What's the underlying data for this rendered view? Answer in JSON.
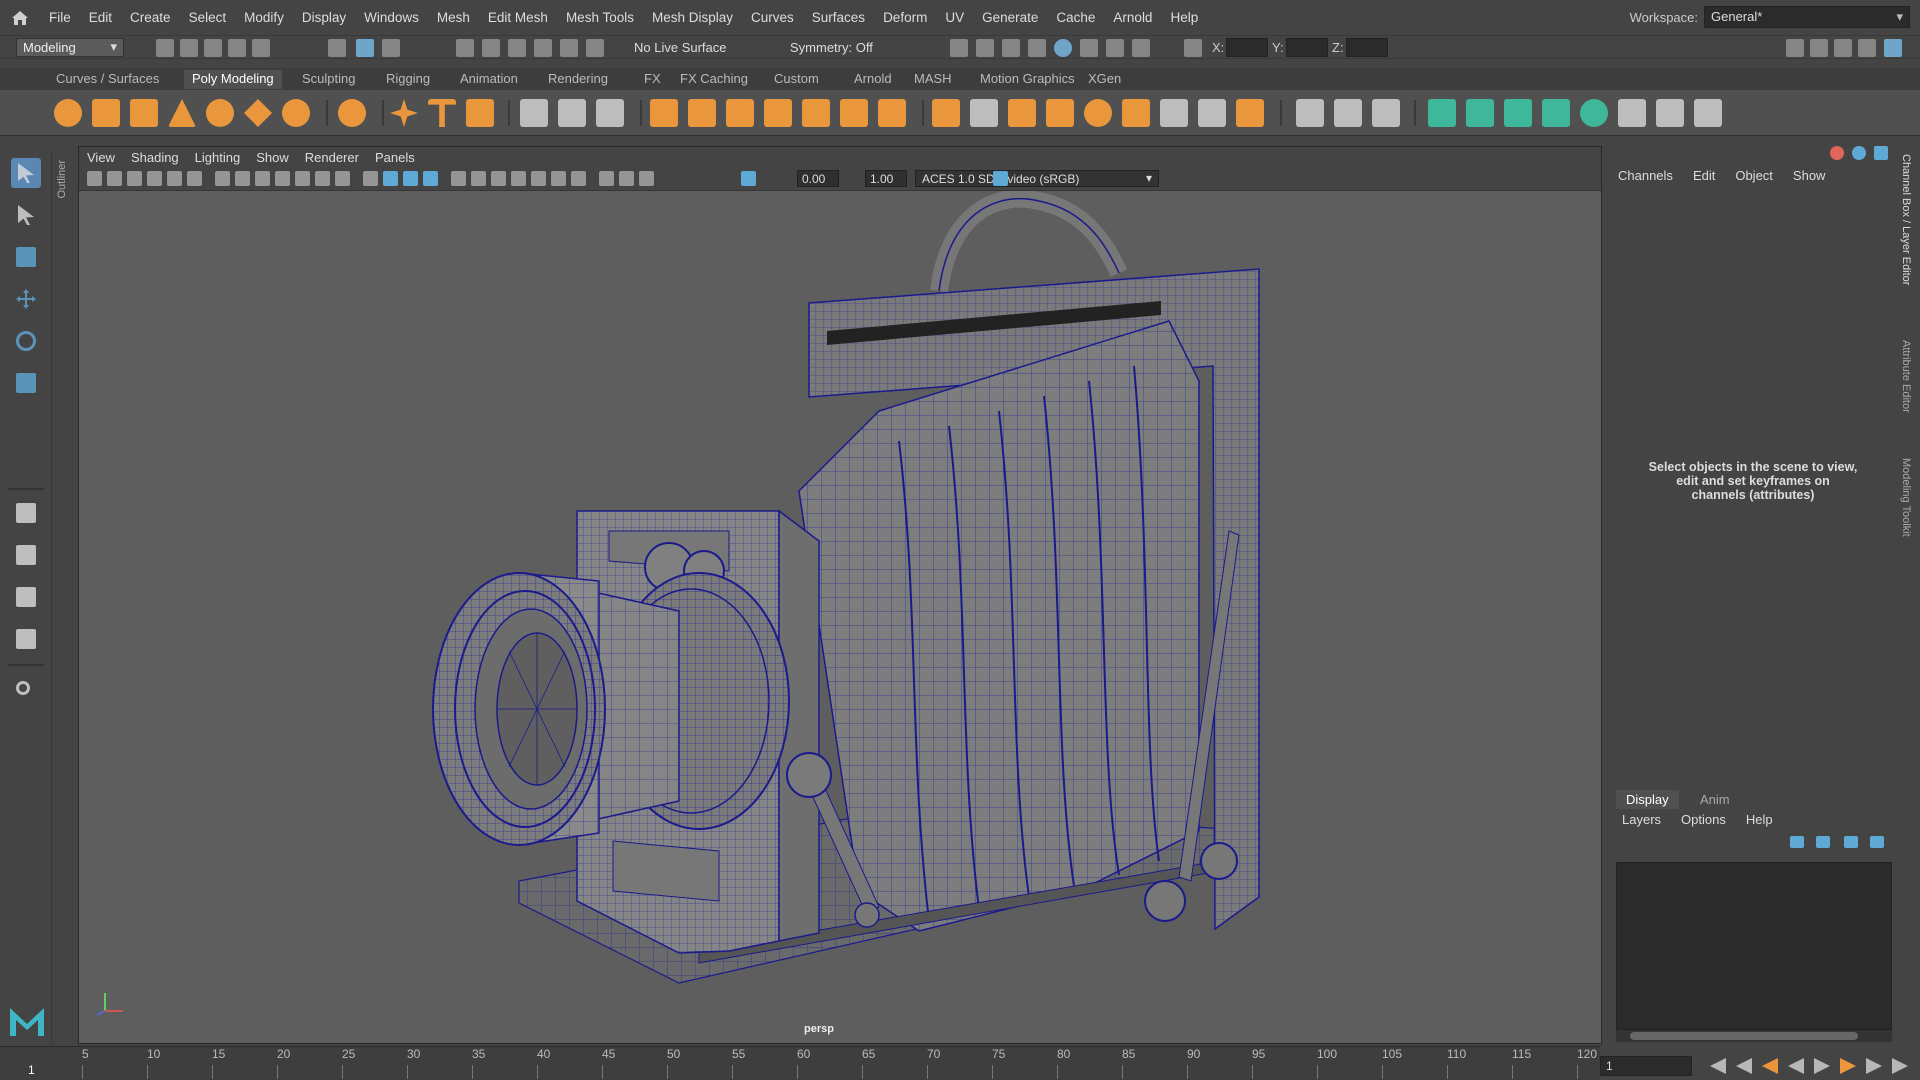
{
  "menus": [
    "File",
    "Edit",
    "Create",
    "Select",
    "Modify",
    "Display",
    "Windows",
    "Mesh",
    "Edit Mesh",
    "Mesh Tools",
    "Mesh Display",
    "Curves",
    "Surfaces",
    "Deform",
    "UV",
    "Generate",
    "Cache",
    "Arnold",
    "Help"
  ],
  "workspace": {
    "label": "Workspace:",
    "value": "General*"
  },
  "status": {
    "mode": "Modeling",
    "live_surface": "No Live Surface",
    "symmetry": "Symmetry: Off",
    "x_label": "X:",
    "y_label": "Y:",
    "z_label": "Z:"
  },
  "shelf_tabs": [
    "Curves / Surfaces",
    "Poly Modeling",
    "Sculpting",
    "Rigging",
    "Animation",
    "Rendering",
    "FX",
    "FX Caching",
    "Custom",
    "Arnold",
    "MASH",
    "Motion Graphics",
    "XGen"
  ],
  "shelf_active": "Poly Modeling",
  "outliner_label": "Outliner",
  "viewport": {
    "menus": [
      "View",
      "Shading",
      "Lighting",
      "Show",
      "Renderer",
      "Panels"
    ],
    "exposure": "0.00",
    "gamma": "1.00",
    "color_space": "ACES 1.0 SDR-video (sRGB)",
    "camera": "persp"
  },
  "channel_box": {
    "menus": [
      "Channels",
      "Edit",
      "Object",
      "Show"
    ],
    "hint": "Select objects in the scene to view, edit and set keyframes on channels (attributes)"
  },
  "side_tabs": [
    "Channel Box / Layer Editor",
    "Attribute Editor",
    "Modeling Toolkit"
  ],
  "layers": {
    "tabs": [
      "Display",
      "Anim"
    ],
    "menus": [
      "Layers",
      "Options",
      "Help"
    ]
  },
  "timeline": {
    "ticks": [
      "5",
      "10",
      "15",
      "20",
      "25",
      "30",
      "35",
      "40",
      "45",
      "50",
      "55",
      "60",
      "65",
      "70",
      "75",
      "80",
      "85",
      "90",
      "95",
      "100",
      "105",
      "110",
      "115",
      "120"
    ],
    "current": "1",
    "frame_field": "1"
  },
  "colors": {
    "accent_blue": "#5a87b3",
    "shelf_orange": "#e9963c",
    "shelf_teal": "#3fb79a",
    "wire": "#1a1a8c"
  }
}
